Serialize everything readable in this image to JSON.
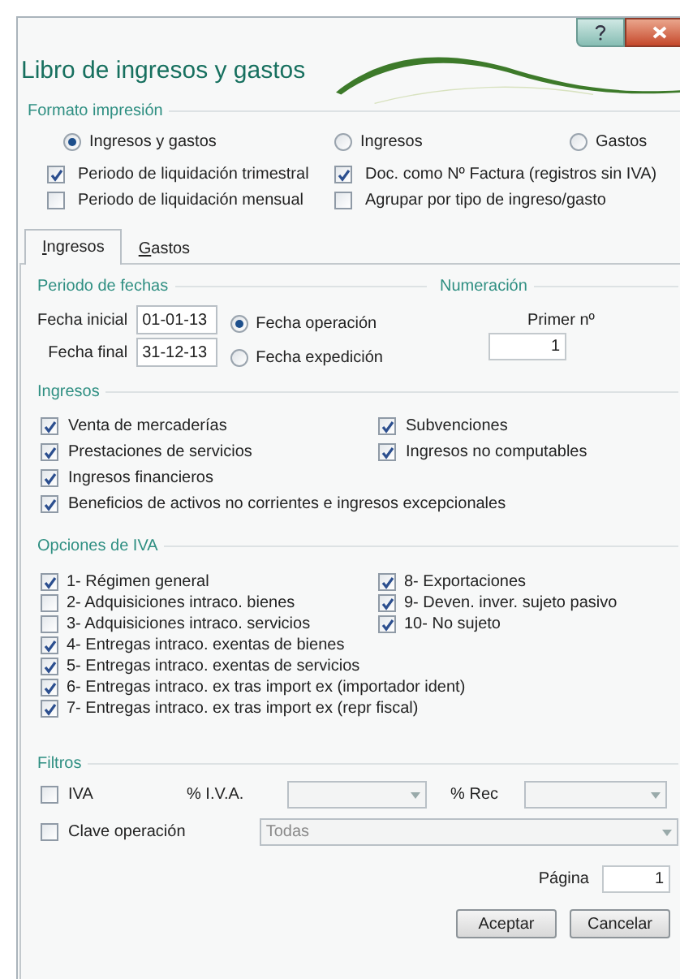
{
  "window": {
    "title": "Libro de ingresos y gastos"
  },
  "formato": {
    "label": "Formato impresión",
    "options": [
      {
        "label": "Ingresos y gastos",
        "selected": true
      },
      {
        "label": "Ingresos",
        "selected": false
      },
      {
        "label": "Gastos",
        "selected": false
      }
    ],
    "checks": [
      {
        "label": "Periodo de liquidación trimestral",
        "checked": true
      },
      {
        "label": "Doc. como Nº Factura (registros sin IVA)",
        "checked": true
      },
      {
        "label": "Periodo de liquidación mensual",
        "checked": false
      },
      {
        "label": "Agrupar por tipo de ingreso/gasto",
        "checked": false
      }
    ]
  },
  "tabs": [
    {
      "label": "Ingresos",
      "selected": true
    },
    {
      "label": "Gastos",
      "selected": false
    }
  ],
  "periodo": {
    "label": "Periodo de fechas",
    "fields": [
      {
        "label": "Fecha inicial",
        "value": "01-01-13"
      },
      {
        "label": "Fecha final",
        "value": "31-12-13"
      }
    ],
    "date_options": [
      {
        "label": "Fecha operación",
        "selected": true
      },
      {
        "label": "Fecha expedición",
        "selected": false
      }
    ]
  },
  "numeracion": {
    "label": "Numeración",
    "field_label": "Primer nº",
    "value": "1"
  },
  "ingresos": {
    "label": "Ingresos",
    "left": [
      {
        "label": "Venta de mercaderías",
        "checked": true
      },
      {
        "label": "Prestaciones de servicios",
        "checked": true
      },
      {
        "label": "Ingresos financieros",
        "checked": true
      },
      {
        "label": "Beneficios de activos no corrientes e  ingresos excepcionales",
        "checked": true
      }
    ],
    "right": [
      {
        "label": "Subvenciones",
        "checked": true
      },
      {
        "label": "Ingresos no computables",
        "checked": true
      }
    ]
  },
  "iva": {
    "label": "Opciones de IVA",
    "left": [
      {
        "label": "1- Régimen general",
        "checked": true
      },
      {
        "label": "2- Adquisiciones intraco. bienes",
        "checked": false
      },
      {
        "label": "3- Adquisiciones intraco. servicios",
        "checked": false
      },
      {
        "label": "4- Entregas intraco. exentas de bienes",
        "checked": true
      },
      {
        "label": "5- Entregas intraco. exentas de servicios",
        "checked": true
      },
      {
        "label": "6- Entregas intraco. ex tras import ex (importador ident)",
        "checked": true
      },
      {
        "label": "7- Entregas intraco. ex tras import ex (repr fiscal)",
        "checked": true
      }
    ],
    "right": [
      {
        "label": "8- Exportaciones",
        "checked": true
      },
      {
        "label": "9- Deven. inver. sujeto pasivo",
        "checked": true
      },
      {
        "label": "10- No sujeto",
        "checked": true
      }
    ]
  },
  "filtros": {
    "label": "Filtros",
    "iva_check": {
      "label": "IVA",
      "checked": false
    },
    "iva_combo": {
      "label": "% I.V.A.",
      "disabled": true
    },
    "rec_combo": {
      "label": "% Rec",
      "disabled": true
    },
    "clave_check": {
      "label": "Clave operación",
      "checked": false
    },
    "clave_combo": {
      "value": "Todas",
      "disabled": true
    }
  },
  "pagina": {
    "label": "Página",
    "value": "1"
  },
  "buttons": [
    "Aceptar",
    "Cancelar"
  ]
}
